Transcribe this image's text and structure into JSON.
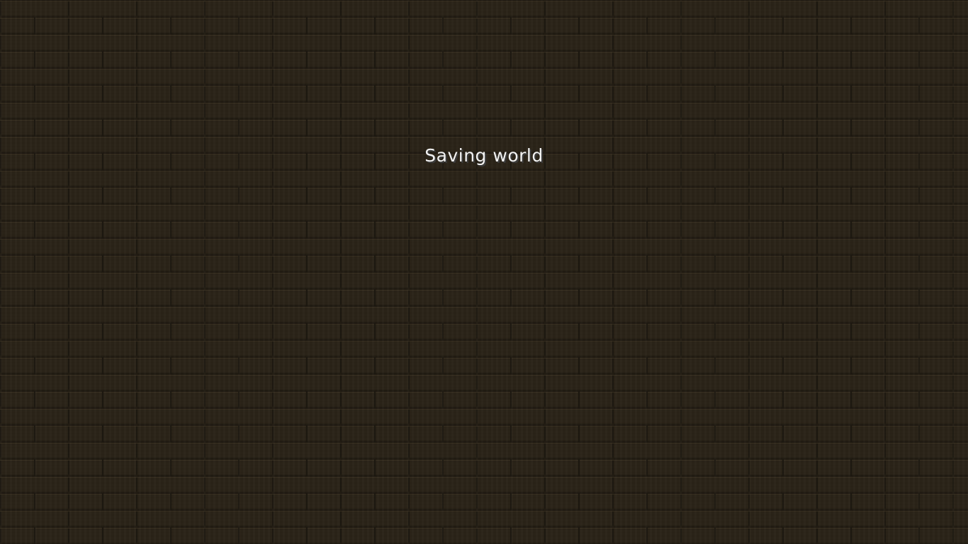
{
  "screen": {
    "status_text": "Saving world"
  },
  "colors": {
    "background": "#2b2418",
    "text": "#f2f2f2",
    "text_shadow": "#3a3a3a"
  }
}
